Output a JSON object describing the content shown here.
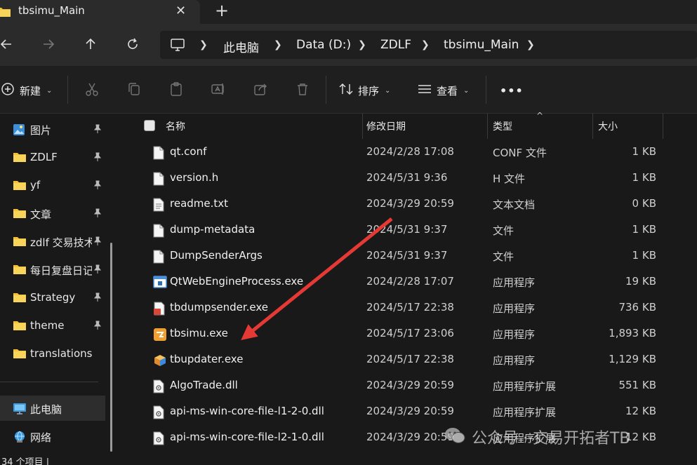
{
  "tab": {
    "title": "tbsimu_Main",
    "close_icon": "close-icon",
    "new_tab_icon": "plus-icon"
  },
  "nav": {
    "back_icon": "arrow-left-icon",
    "forward_icon": "arrow-right-icon",
    "up_icon": "arrow-up-icon",
    "refresh_icon": "refresh-icon",
    "breadcrumb": [
      "此电脑",
      "Data (D:)",
      "ZDLF",
      "tbsimu_Main"
    ],
    "computer_icon": "monitor-icon"
  },
  "toolbar": {
    "new_label": "新建",
    "sort_label": "排序",
    "view_label": "查看",
    "more_label": "•••",
    "icons": [
      "cut-icon",
      "copy-icon",
      "paste-icon",
      "rename-icon",
      "share-icon",
      "delete-icon"
    ]
  },
  "sidebar": {
    "items": [
      {
        "label": "图片",
        "icon": "pictures-icon",
        "pinned": true
      },
      {
        "label": "ZDLF",
        "icon": "folder-icon",
        "pinned": true
      },
      {
        "label": "yf",
        "icon": "folder-icon",
        "pinned": true
      },
      {
        "label": "文章",
        "icon": "folder-icon",
        "pinned": true
      },
      {
        "label": "zdlf 交易技术",
        "icon": "folder-icon",
        "pinned": true
      },
      {
        "label": "每日复盘日记",
        "icon": "folder-icon",
        "pinned": true
      },
      {
        "label": "Strategy",
        "icon": "folder-icon",
        "pinned": true
      },
      {
        "label": "theme",
        "icon": "folder-icon",
        "pinned": true
      },
      {
        "label": "translations",
        "icon": "folder-icon",
        "pinned": false
      }
    ],
    "this_pc": "此电脑",
    "network": "网络"
  },
  "columns": {
    "name": "名称",
    "date": "修改日期",
    "type": "类型",
    "size": "大小"
  },
  "files": [
    {
      "name": "qt.conf",
      "date": "2024/2/28 17:08",
      "type": "CONF 文件",
      "size": "1 KB",
      "icon": "file-icon"
    },
    {
      "name": "version.h",
      "date": "2024/5/31 9:36",
      "type": "H 文件",
      "size": "1 KB",
      "icon": "file-icon"
    },
    {
      "name": "readme.txt",
      "date": "2024/3/29 20:59",
      "type": "文本文档",
      "size": "0 KB",
      "icon": "text-file-icon"
    },
    {
      "name": "dump-metadata",
      "date": "2024/5/31 9:37",
      "type": "文件",
      "size": "1 KB",
      "icon": "file-icon"
    },
    {
      "name": "DumpSenderArgs",
      "date": "2024/5/31 9:37",
      "type": "文件",
      "size": "1 KB",
      "icon": "file-icon"
    },
    {
      "name": "QtWebEngineProcess.exe",
      "date": "2024/2/28 17:07",
      "type": "应用程序",
      "size": "19 KB",
      "icon": "app-window-icon"
    },
    {
      "name": "tbdumpsender.exe",
      "date": "2024/5/17 22:38",
      "type": "应用程序",
      "size": "736 KB",
      "icon": "app-red-icon"
    },
    {
      "name": "tbsimu.exe",
      "date": "2024/5/17 23:06",
      "type": "应用程序",
      "size": "1,893 KB",
      "icon": "app-orange-icon"
    },
    {
      "name": "tbupdater.exe",
      "date": "2024/5/17 22:38",
      "type": "应用程序",
      "size": "1,129 KB",
      "icon": "app-box-icon"
    },
    {
      "name": "AlgoTrade.dll",
      "date": "2024/3/29 20:59",
      "type": "应用程序扩展",
      "size": "551 KB",
      "icon": "dll-icon"
    },
    {
      "name": "api-ms-win-core-file-l1-2-0.dll",
      "date": "2024/3/29 20:59",
      "type": "应用程序扩展",
      "size": "12 KB",
      "icon": "dll-icon"
    },
    {
      "name": "api-ms-win-core-file-l2-1-0.dll",
      "date": "2024/3/29 20:59",
      "type": "应用程序扩展",
      "size": "12 KB",
      "icon": "dll-icon"
    }
  ],
  "status": {
    "text": "34 个项目  |"
  },
  "watermark": {
    "text": "公众号 · 交易开拓者TB"
  },
  "colors": {
    "accent_folder": "#f4c233",
    "arrow": "#e53935",
    "background": "#191919"
  }
}
